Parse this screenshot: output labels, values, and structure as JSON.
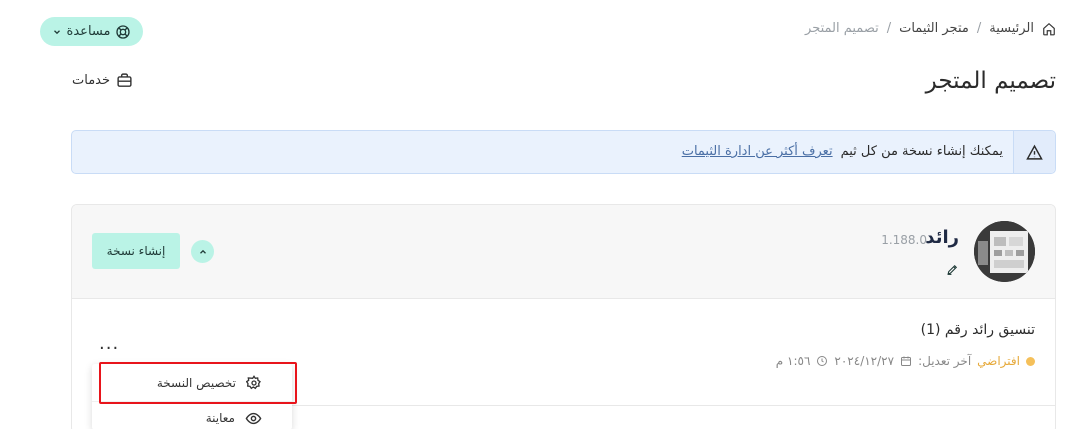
{
  "breadcrumb": {
    "home": "الرئيسية",
    "store": "متجر الثيمات",
    "current": "تصميم المتجر",
    "separator": "/"
  },
  "help": {
    "label": "مساعدة"
  },
  "page": {
    "title": "تصميم المتجر"
  },
  "services": {
    "label": "خدمات"
  },
  "alert": {
    "text": "يمكنك إنشاء نسخة من كل ثيم",
    "link": "تعرف أكثر عن ادارة الثيمات"
  },
  "theme": {
    "name": "رائد",
    "version": "1.188.0",
    "create_copy_label": "إنشاء نسخة"
  },
  "version_item": {
    "title": "تنسيق رائد رقم (1)",
    "status": "افتراضي",
    "last_modified_label": "آخر تعديل:",
    "date": "٢٠٢٤/١٢/٢٧",
    "time": "١:٥٦ م",
    "more": "..."
  },
  "menu": {
    "customize": "تخصيص النسخة",
    "preview": "معاينة"
  },
  "colors": {
    "accent": "#baf3e6",
    "status_default": "#f5c05a",
    "highlight": "#e8141b"
  }
}
